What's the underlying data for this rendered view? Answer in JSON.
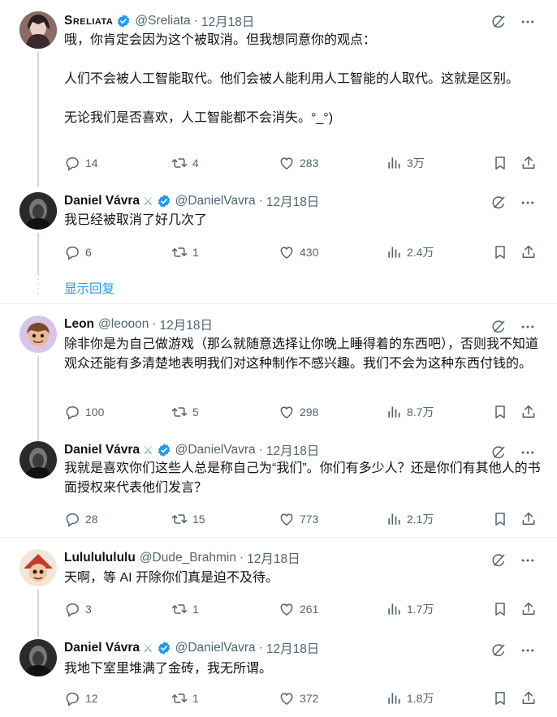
{
  "tweets": [
    {
      "name": "Sreliata",
      "handle": "@Sreliata",
      "sep": "·",
      "date": "12月18日",
      "text": "哦，你肯定会因为这个被取消。但我想同意你的观点：\n\n人们不会被人工智能取代。他们会被人能利用人工智能的人取代。这就是区别。\n\n无论我们是否喜欢，人工智能都不会消失。°_°)",
      "replies": "14",
      "retweets": "4",
      "likes": "283",
      "views": "3万",
      "avatar_color": "#6b4a4a"
    },
    {
      "name": "Daniel Vávra",
      "handle": "@DanielVavra",
      "sep": "·",
      "date": "12月18日",
      "text": "我已经被取消了好几次了",
      "replies": "6",
      "retweets": "1",
      "likes": "430",
      "views": "2.4万",
      "avatar_color": "#2a2a2a"
    },
    {
      "name": "Leon",
      "handle": "@leooon",
      "sep": "·",
      "date": "12月18日",
      "text": "除非你是为自己做游戏（那么就随意选择让你晚上睡得着的东西吧），否则我不知道观众还能有多清楚地表明我们对这种制作不感兴趣。我们不会为这种东西付钱的。",
      "replies": "100",
      "retweets": "5",
      "likes": "298",
      "views": "8.7万",
      "avatar_color": "#d9c7e8"
    },
    {
      "name": "Daniel Vávra",
      "handle": "@DanielVavra",
      "sep": "·",
      "date": "12月18日",
      "text": "我就是喜欢你们这些人总是称自己为“我们”。你们有多少人？还是你们有其他人的书面授权来代表他们发言？",
      "replies": "28",
      "retweets": "15",
      "likes": "773",
      "views": "2.1万",
      "avatar_color": "#2a2a2a"
    },
    {
      "name": "Lulululululu",
      "handle": "@Dude_Brahmin",
      "sep": "·",
      "date": "12月18日",
      "text": "天啊，等 AI 开除你们真是迫不及待。",
      "replies": "3",
      "retweets": "1",
      "likes": "261",
      "views": "1.7万",
      "avatar_color": "#c43b2a"
    },
    {
      "name": "Daniel Vávra",
      "handle": "@DanielVavra",
      "sep": "·",
      "date": "12月18日",
      "text": "我地下室里堆满了金砖，我无所谓。",
      "replies": "12",
      "retweets": "1",
      "likes": "372",
      "views": "1.8万",
      "avatar_color": "#2a2a2a"
    }
  ],
  "show_replies_label": "显示回复",
  "icons": {
    "grok": "grok-icon",
    "more": "more-icon",
    "reply": "reply-icon",
    "retweet": "retweet-icon",
    "like": "like-icon",
    "views": "views-icon",
    "bookmark": "bookmark-icon",
    "share": "share-icon",
    "verified": "verified-badge-icon",
    "swords": "crossed-swords-icon"
  },
  "colors": {
    "accent": "#1d9bf0",
    "secondary_text": "#536471",
    "divider": "#eff3f4"
  }
}
